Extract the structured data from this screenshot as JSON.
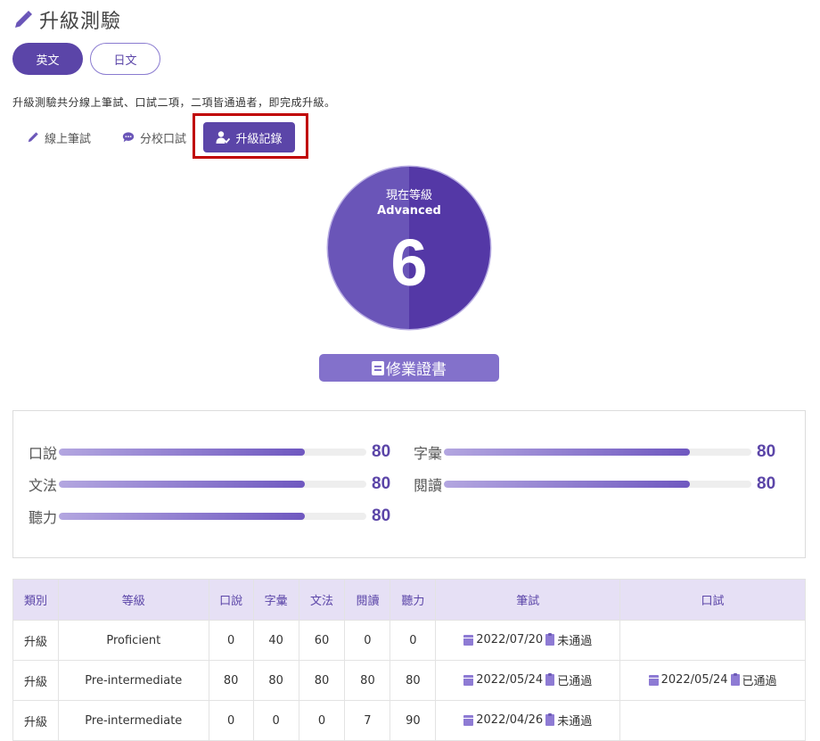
{
  "header": {
    "title": "升級測驗",
    "icon": "pencil-icon"
  },
  "language_tabs": [
    {
      "label": "英文",
      "active": true
    },
    {
      "label": "日文",
      "active": false
    }
  ],
  "description": "升級測驗共分線上筆試、口試二項，二項皆通過者，即完成升級。",
  "sub_tabs": [
    {
      "label": "線上筆試",
      "icon": "pencil-icon"
    },
    {
      "label": "分校口試",
      "icon": "chat-bubble-icon"
    },
    {
      "label": "升級記錄",
      "icon": "user-check-icon",
      "active": true
    }
  ],
  "level": {
    "label": "現在等級",
    "name": "Advanced",
    "number": "6"
  },
  "certificate_button": "修業證書",
  "scores": [
    {
      "label": "口說",
      "value": "80"
    },
    {
      "label": "字彙",
      "value": "80"
    },
    {
      "label": "文法",
      "value": "80"
    },
    {
      "label": "閱讀",
      "value": "80"
    },
    {
      "label": "聽力",
      "value": "80"
    }
  ],
  "score_max": 100,
  "table": {
    "headers": [
      "類別",
      "等級",
      "口說",
      "字彙",
      "文法",
      "閱讀",
      "聽力",
      "筆試",
      "口試"
    ],
    "rows": [
      {
        "category": "升級",
        "level": "Proficient",
        "speaking": "0",
        "vocab": "40",
        "grammar": "60",
        "reading": "0",
        "listening": "0",
        "written_date": "2022/07/20",
        "written_status": "未通過",
        "oral_date": "",
        "oral_status": ""
      },
      {
        "category": "升級",
        "level": "Pre-intermediate",
        "speaking": "80",
        "vocab": "80",
        "grammar": "80",
        "reading": "80",
        "listening": "80",
        "written_date": "2022/05/24",
        "written_status": "已通過",
        "oral_date": "2022/05/24",
        "oral_status": "已通過"
      },
      {
        "category": "升級",
        "level": "Pre-intermediate",
        "speaking": "0",
        "vocab": "0",
        "grammar": "0",
        "reading": "7",
        "listening": "90",
        "written_date": "2022/04/26",
        "written_status": "未通過",
        "oral_date": "",
        "oral_status": ""
      }
    ]
  },
  "colors": {
    "accent": "#5b45a8",
    "accent_light": "#8371cb",
    "highlight": "#c00000",
    "table_header": "#e6e0f5"
  }
}
